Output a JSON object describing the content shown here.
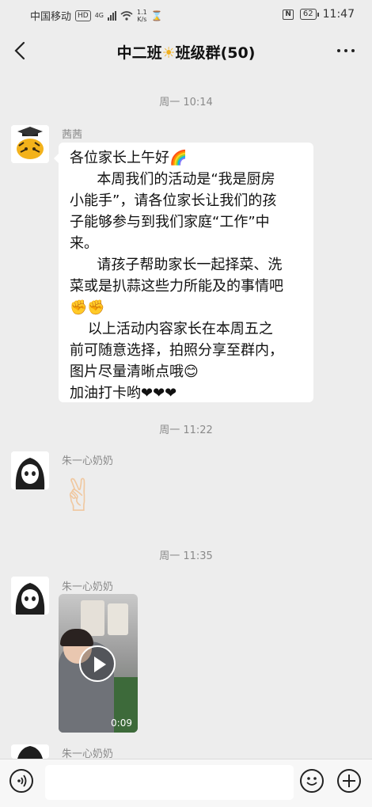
{
  "status_bar": {
    "carrier": "中国移动",
    "hd": "HD",
    "net_type": "4G",
    "speed_value": "1.1",
    "speed_unit": "K/s",
    "nfc": "N",
    "battery": "62",
    "time": "11:47"
  },
  "nav": {
    "title_part1": "中二班",
    "title_part2": "班级群(50)"
  },
  "messages": [
    {
      "time": "周一 10:14",
      "sender": "茜茜",
      "lines": [
        "各位家长上午好🌈",
        "      本周我们的活动是“我是厨房",
        "小能手”，请各位家长让我们的孩",
        "子能够参与到我们家庭“工作”中",
        "来。",
        "      请孩子帮助家长一起择菜、洗",
        "菜或是扒蒜这些力所能及的事情吧",
        "✊✊",
        "    以上活动内容家长在本周五之",
        "前可随意选择，拍照分享至群内，",
        "图片尽量清晰点哦😊",
        "加油打卡哟❤❤❤"
      ]
    },
    {
      "time": "周一 11:22",
      "sender": "朱一心奶奶",
      "emoji": "✌"
    },
    {
      "time": "周一 11:35",
      "sender": "朱一心奶奶",
      "video_duration": "0:09"
    },
    {
      "sender": "朱一心奶奶"
    }
  ]
}
